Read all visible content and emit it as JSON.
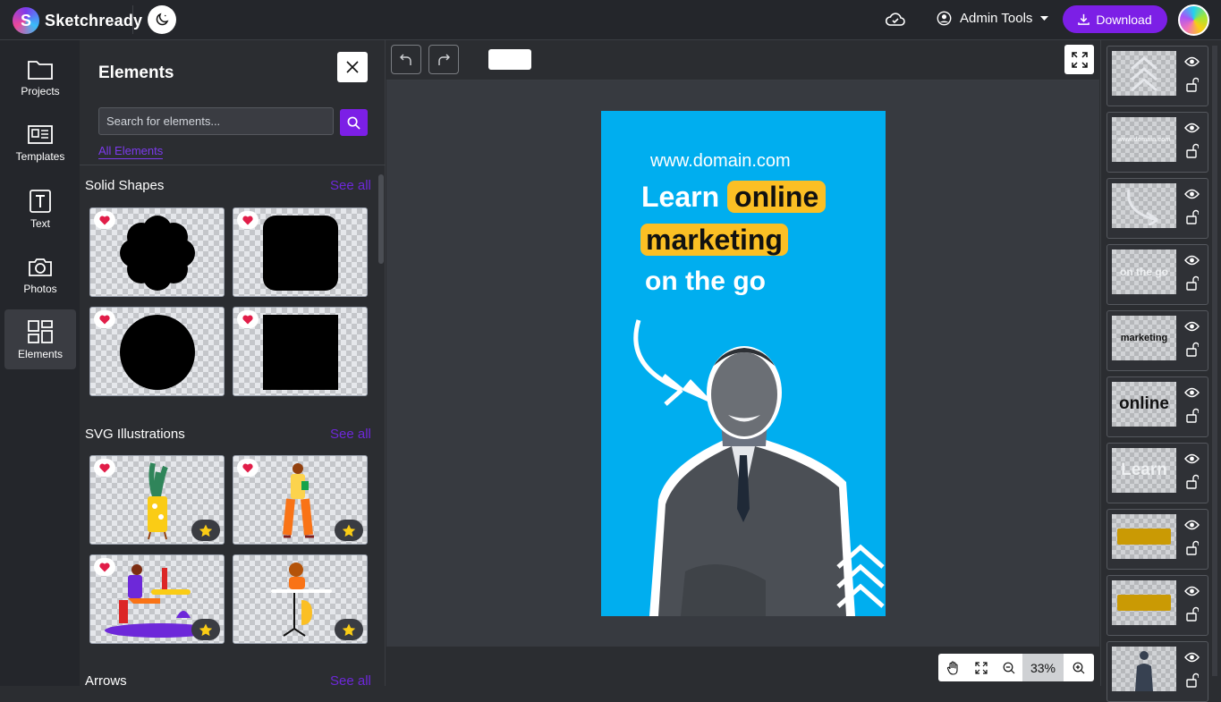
{
  "app": {
    "name": "Sketchready"
  },
  "topbar": {
    "admin_label": "Admin Tools",
    "download_label": "Download"
  },
  "nav": [
    {
      "label": "Projects",
      "icon": "folder-icon"
    },
    {
      "label": "Templates",
      "icon": "templates-icon"
    },
    {
      "label": "Text",
      "icon": "text-icon"
    },
    {
      "label": "Photos",
      "icon": "camera-icon"
    },
    {
      "label": "Elements",
      "icon": "elements-icon",
      "active": true
    }
  ],
  "panel": {
    "title": "Elements",
    "search_placeholder": "Search for elements...",
    "tab_label": "All Elements",
    "sections": [
      {
        "title": "Solid Shapes",
        "see_all": "See all"
      },
      {
        "title": "SVG Illustrations",
        "see_all": "See all"
      },
      {
        "title": "Arrows",
        "see_all": "See all"
      }
    ]
  },
  "canvas": {
    "zoom": "33%",
    "poster": {
      "domain": "www.domain.com",
      "word_learn": "Learn",
      "word_online": "online",
      "word_marketing": "marketing",
      "line_on_the_go": "on the go",
      "background_color": "#00aeef",
      "highlight_color": "#fbbf24"
    }
  },
  "layers": [
    {
      "thumb_text": "",
      "kind": "chevrons"
    },
    {
      "thumb_text": "www.domain.com",
      "kind": "text-faint"
    },
    {
      "thumb_text": "",
      "kind": "arrow"
    },
    {
      "thumb_text": "on the go",
      "kind": "text-faint"
    },
    {
      "thumb_text": "marketing",
      "kind": "text-dark-small"
    },
    {
      "thumb_text": "online",
      "kind": "text-dark"
    },
    {
      "thumb_text": "Learn",
      "kind": "text-faint"
    },
    {
      "thumb_text": "",
      "kind": "bar"
    },
    {
      "thumb_text": "",
      "kind": "bar"
    },
    {
      "thumb_text": "",
      "kind": "person"
    }
  ],
  "colors": {
    "accent": "#7c1fe6",
    "link": "#6d28d9"
  }
}
